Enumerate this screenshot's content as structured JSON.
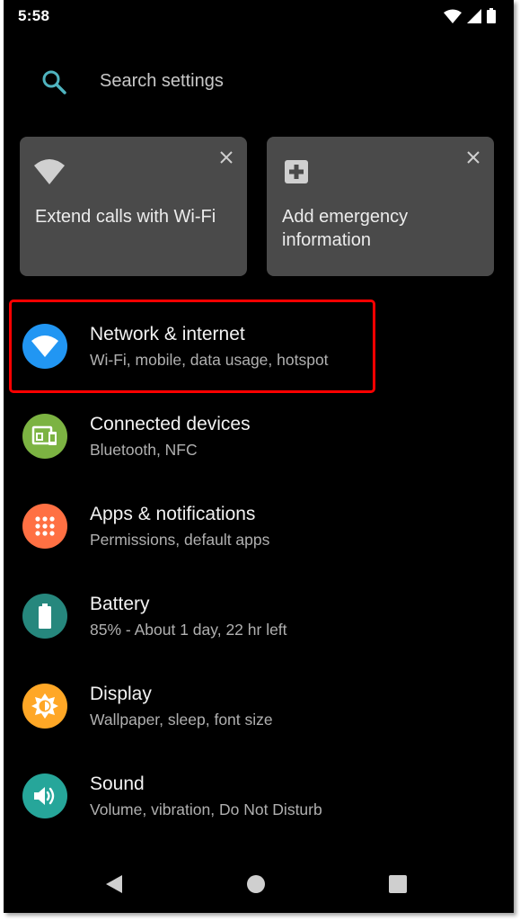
{
  "status_bar": {
    "time": "5:58",
    "icons": [
      "wifi-icon",
      "cell-signal-icon",
      "battery-icon"
    ]
  },
  "search": {
    "placeholder": "Search settings",
    "icon": "search-icon",
    "icon_color": "#4fb3bf"
  },
  "suggestions": [
    {
      "label": "Extend calls with Wi-Fi",
      "icon": "wifi-icon",
      "dismiss_icon": "close-icon"
    },
    {
      "label": "Add emergency information",
      "icon": "medical-plus-icon",
      "dismiss_icon": "close-icon"
    }
  ],
  "settings": [
    {
      "title": "Network & internet",
      "subtitle": "Wi-Fi, mobile, data usage, hotspot",
      "icon": "wifi-icon",
      "color": "#2196f3",
      "highlighted": true
    },
    {
      "title": "Connected devices",
      "subtitle": "Bluetooth, NFC",
      "icon": "devices-icon",
      "color": "#7cb342"
    },
    {
      "title": "Apps & notifications",
      "subtitle": "Permissions, default apps",
      "icon": "apps-grid-icon",
      "color": "#ff7043"
    },
    {
      "title": "Battery",
      "subtitle": "85% - About 1 day, 22 hr left",
      "icon": "battery-icon",
      "color": "#26877d"
    },
    {
      "title": "Display",
      "subtitle": "Wallpaper, sleep, font size",
      "icon": "brightness-icon",
      "color": "#ffa726"
    },
    {
      "title": "Sound",
      "subtitle": "Volume, vibration, Do Not Disturb",
      "icon": "volume-icon",
      "color": "#26a69a"
    }
  ],
  "nav_bar": {
    "icons": [
      "back-icon",
      "home-icon",
      "recents-icon"
    ]
  },
  "highlight_color": "#ff0000"
}
